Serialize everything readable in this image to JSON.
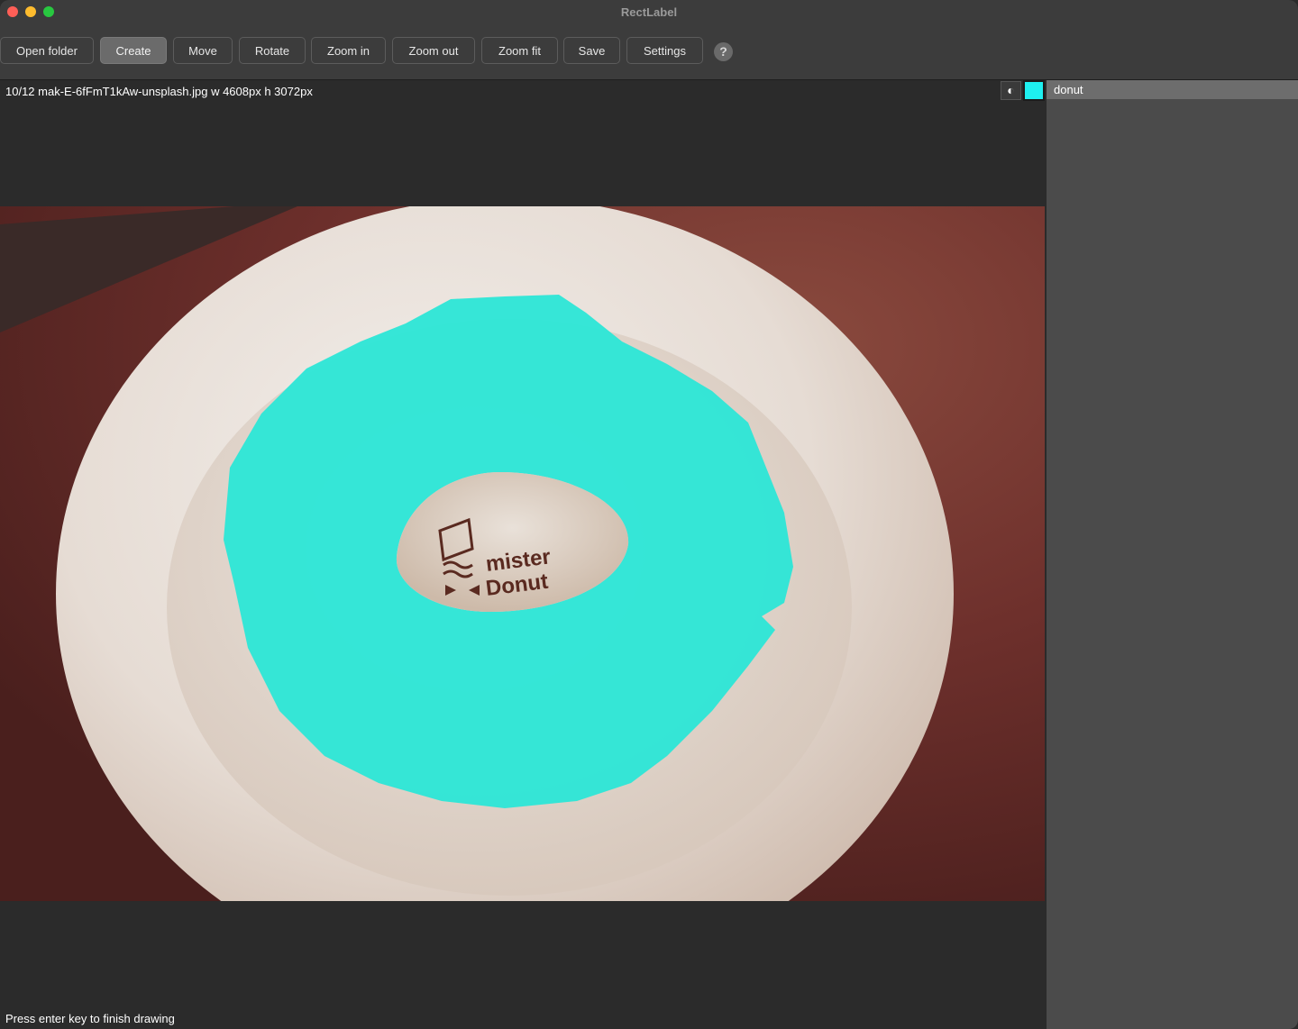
{
  "window": {
    "title": "RectLabel"
  },
  "toolbar": {
    "buttons": [
      {
        "label": "Open folder"
      },
      {
        "label": "Create"
      },
      {
        "label": "Move"
      },
      {
        "label": "Rotate"
      },
      {
        "label": "Zoom in"
      },
      {
        "label": "Zoom out"
      },
      {
        "label": "Zoom fit"
      },
      {
        "label": "Save"
      },
      {
        "label": "Settings"
      }
    ],
    "active_tool": "Create",
    "help_label": "?"
  },
  "canvas": {
    "file_info": "10/12 mak-E-6fFmT1kAw-unsplash.jpg w 4608px h 3072px",
    "status": "Press enter key to finish drawing",
    "image_logo_text": [
      "mister",
      "Donut"
    ]
  },
  "labels_panel": {
    "contrast_icon": "half-circle-icon",
    "current_color": "#1ef0f0",
    "items": [
      {
        "name": "donut"
      }
    ]
  }
}
